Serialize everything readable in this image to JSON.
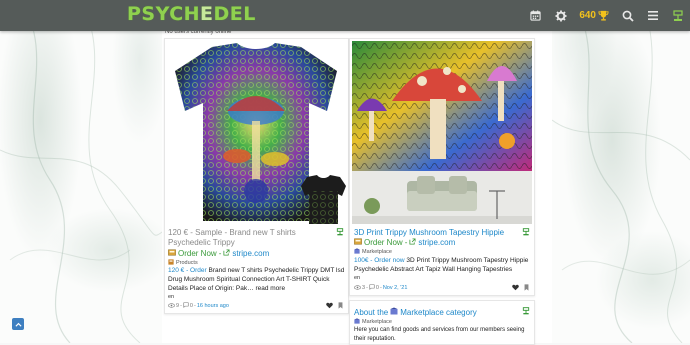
{
  "header": {
    "logo_main": "PSYCH",
    "logo_accent": "E",
    "logo_end": "DEL",
    "score": "640",
    "icons": [
      "calendar-icon",
      "gear-icon",
      "trophy-icon",
      "search-icon",
      "menu-icon",
      "marketplace-icon"
    ]
  },
  "status": {
    "online": "No users currently online"
  },
  "cards": [
    {
      "title": "120 € - Sample - Brand new T shirts Psychedelic Trippy",
      "order_now": "Order Now",
      "separator": "-",
      "link": "stripe.com",
      "category": "Products",
      "desc_prefix": "120 € - Order",
      "desc_text": "Brand new T shirts Psychedelic Trippy DMT lsd Drug Mushroom Spiritual Connection Art T-SHIRT Quick Details Place of Origin: Pak…",
      "read_more": "read more",
      "lang": "en",
      "views": "9",
      "comments": "0",
      "time": "16 hours ago"
    },
    {
      "title": "3D Print Trippy Mushroom Tapestry Hippie",
      "order_now": "Order Now",
      "separator": "-",
      "link": "stripe.com",
      "category": "Marketplace",
      "desc_prefix": "100€ - Order now",
      "desc_text": "3D Print Trippy Mushroom Tapestry Hippie Psychedelic Abstract Art Tapiz Wall Hanging Tapestries",
      "lang": "en",
      "views": "3",
      "comments": "0",
      "time": "Nov 2, '21"
    },
    {
      "title_prefix": "About the",
      "title_link": "Marketplace category",
      "category": "Marketplace",
      "desc_text": "Here you can find goods and services from our members seeing their reputation."
    }
  ],
  "colors": {
    "header_bg": "#555b59",
    "logo": "#8fd14f",
    "link": "#1e88c9",
    "order_green": "#3a9a3a",
    "score": "#f3c21c"
  }
}
